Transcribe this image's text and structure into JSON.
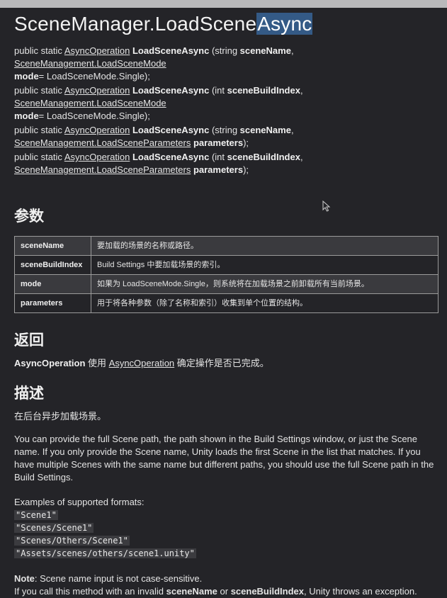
{
  "title": {
    "prefix": "SceneManager.LoadScene",
    "selected": "Async"
  },
  "signatures": [
    {
      "pre": "public static ",
      "ret_type": "AsyncOperation",
      "method": "LoadSceneAsync",
      "p1_open": " (string ",
      "p1_name": "sceneName",
      "sep": ", ",
      "p2_type": "SceneManagement.LoadSceneMode",
      "p2_name": "mode",
      "tail": "= LoadSceneMode.Single);"
    },
    {
      "pre": "public static ",
      "ret_type": "AsyncOperation",
      "method": "LoadSceneAsync",
      "p1_open": " (int ",
      "p1_name": "sceneBuildIndex",
      "sep": ", ",
      "p2_type": "SceneManagement.LoadSceneMode",
      "p2_name": "mode",
      "tail": "= LoadSceneMode.Single);"
    },
    {
      "pre": "public static ",
      "ret_type": "AsyncOperation",
      "method": "LoadSceneAsync",
      "p1_open": " (string ",
      "p1_name": "sceneName",
      "sep": ",",
      "p2_type": "SceneManagement.LoadSceneParameters",
      "p2_name": "parameters",
      "tail": ");"
    },
    {
      "pre": "public static ",
      "ret_type": "AsyncOperation",
      "method": "LoadSceneAsync",
      "p1_open": " (int ",
      "p1_name": "sceneBuildIndex",
      "sep": ",",
      "p2_type": "SceneManagement.LoadSceneParameters",
      "p2_name": "parameters",
      "tail": ");"
    }
  ],
  "params_heading": "参数",
  "params": [
    {
      "name": "sceneName",
      "desc": "要加载的场景的名称或路径。"
    },
    {
      "name": "sceneBuildIndex",
      "desc": "Build Settings 中要加载场景的索引。"
    },
    {
      "name": "mode",
      "desc": "如果为 LoadSceneMode.Single，则系统将在加载场景之前卸载所有当前场景。"
    },
    {
      "name": "parameters",
      "desc": "用于将各种参数（除了名称和索引）收集到单个位置的结构。"
    }
  ],
  "returns_heading": "返回",
  "returns": {
    "type": "AsyncOperation",
    "mid": " 使用 ",
    "link": "AsyncOperation",
    "tail": " 确定操作是否已完成。"
  },
  "description_heading": "描述",
  "description": {
    "p1": "在后台异步加载场景。",
    "p2": "You can provide the full Scene path, the path shown in the Build Settings window, or just the Scene name. If you only provide the Scene name, Unity loads the first Scene in the list that matches. If you have multiple Scenes with the same name but different paths, you should use the full Scene path in the Build Settings.",
    "examples_label": "Examples of supported formats:",
    "examples": [
      "\"Scene1\"",
      "\"Scenes/Scene1\"",
      "\"Scenes/Others/Scene1\"",
      "\"Assets/scenes/others/scene1.unity\""
    ],
    "note_label": "Note",
    "note_text": ": Scene name input is not case-sensitive.",
    "last_pre": "If you call this method with an invalid ",
    "last_b1": "sceneName",
    "last_mid": " or ",
    "last_b2": "sceneBuildIndex",
    "last_tail": ", Unity throws an exception."
  }
}
